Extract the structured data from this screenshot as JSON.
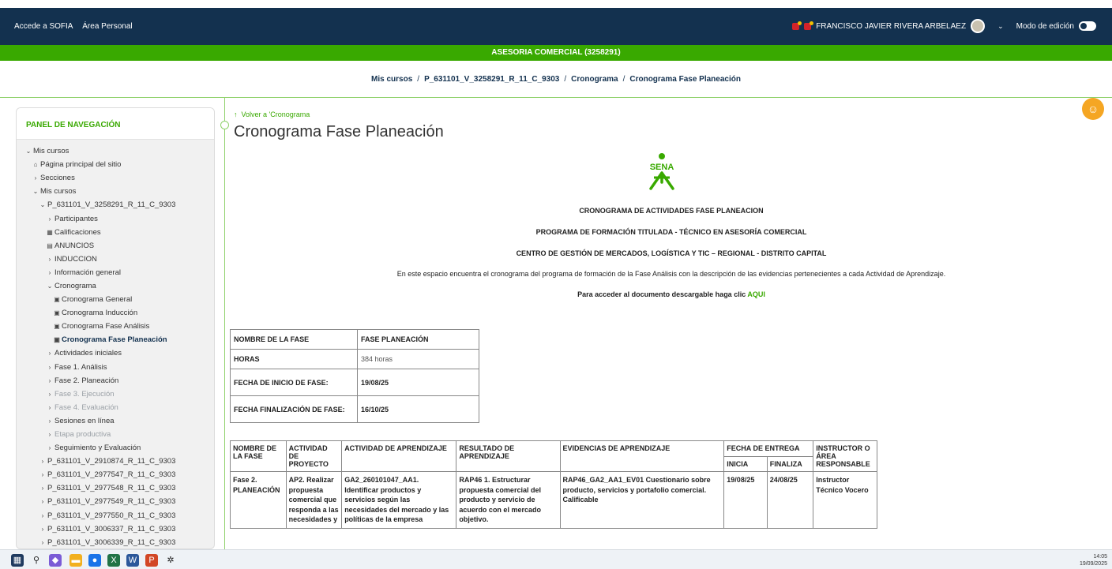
{
  "topbar": {
    "links": [
      "Accede a SOFIA",
      "Área Personal"
    ],
    "user_name": "FRANCISCO JAVIER RIVERA ARBELAEZ",
    "edit_mode_label": "Modo de edición"
  },
  "course_banner": "ASESORIA COMERCIAL (3258291)",
  "breadcrumb": [
    "Mis cursos",
    "P_631101_V_3258291_R_11_C_9303",
    "Cronograma",
    "Cronograma Fase Planeación"
  ],
  "sidebar": {
    "title": "PANEL DE NAVEGACIÓN",
    "items": [
      {
        "label": "Mis cursos",
        "icon": "v",
        "indent": 0
      },
      {
        "label": "Página principal del sitio",
        "icon": "home-icon",
        "indent": 1
      },
      {
        "label": "Secciones",
        "icon": ">",
        "indent": 1
      },
      {
        "label": "Mis cursos",
        "icon": "v",
        "indent": 1
      },
      {
        "label": "P_631101_V_3258291_R_11_C_9303",
        "icon": "v",
        "indent": 2
      },
      {
        "label": "Participantes",
        "icon": ">",
        "indent": 3
      },
      {
        "label": "Calificaciones",
        "icon": "grid-icon",
        "indent": 3
      },
      {
        "label": "ANUNCIOS",
        "icon": "forum-icon",
        "indent": 3
      },
      {
        "label": "INDUCCION",
        "icon": ">",
        "indent": 3
      },
      {
        "label": "Información general",
        "icon": ">",
        "indent": 3
      },
      {
        "label": "Cronograma",
        "icon": "v",
        "indent": 3
      },
      {
        "label": "Cronograma General",
        "icon": "page-icon",
        "indent": 4
      },
      {
        "label": "Cronograma Inducción",
        "icon": "page-icon",
        "indent": 4
      },
      {
        "label": "Cronograma Fase Análisis",
        "icon": "page-icon",
        "indent": 4
      },
      {
        "label": "Cronograma Fase Planeación",
        "icon": "page-icon",
        "indent": 4,
        "active": true
      },
      {
        "label": "Actividades iniciales",
        "icon": ">",
        "indent": 3
      },
      {
        "label": "Fase 1. Análisis",
        "icon": ">",
        "indent": 3
      },
      {
        "label": "Fase 2. Planeación",
        "icon": ">",
        "indent": 3
      },
      {
        "label": "Fase 3. Ejecución",
        "icon": ">",
        "indent": 3,
        "dim": true
      },
      {
        "label": "Fase 4. Evaluación",
        "icon": ">",
        "indent": 3,
        "dim": true
      },
      {
        "label": "Sesiones en línea",
        "icon": ">",
        "indent": 3
      },
      {
        "label": "Etapa productiva",
        "icon": ">",
        "indent": 3,
        "dim": true
      },
      {
        "label": "Seguimiento y Evaluación",
        "icon": ">",
        "indent": 3
      },
      {
        "label": "P_631101_V_2910874_R_11_C_9303",
        "icon": ">",
        "indent": 2
      },
      {
        "label": "P_631101_V_2977547_R_11_C_9303",
        "icon": ">",
        "indent": 2
      },
      {
        "label": "P_631101_V_2977548_R_11_C_9303",
        "icon": ">",
        "indent": 2
      },
      {
        "label": "P_631101_V_2977549_R_11_C_9303",
        "icon": ">",
        "indent": 2
      },
      {
        "label": "P_631101_V_2977550_R_11_C_9303",
        "icon": ">",
        "indent": 2
      },
      {
        "label": "P_631101_V_3006337_R_11_C_9303",
        "icon": ">",
        "indent": 2
      },
      {
        "label": "P_631101_V_3006339_R_11_C_9303",
        "icon": ">",
        "indent": 2
      }
    ]
  },
  "main": {
    "back_link": "Volver a 'Cronograma",
    "page_title": "Cronograma Fase Planeación",
    "logo_text": "SENA",
    "heading1": "CRONOGRAMA  DE ACTIVIDADES FASE PLANEACION",
    "heading2": "PROGRAMA DE FORMACIÓN TITULADA - TÉCNICO EN ASESORÍA COMERCIAL",
    "heading3": "CENTRO DE GESTIÓN DE MERCADOS, LOGÍSTICA Y TIC – REGIONAL - DISTRITO CAPITAL",
    "intro": "En este espacio encuentra el cronograma del programa de formación de la Fase Análisis con la descripción de las evidencias pertenecientes a cada Actividad de Aprendizaje.",
    "download_prefix": "Para acceder al documento descargable haga clic",
    "download_link": "AQUI"
  },
  "phase_table": [
    {
      "label": "NOMBRE DE LA FASE",
      "value": "FASE PLANEACIÓN"
    },
    {
      "label": "HORAS",
      "value": "384 horas"
    },
    {
      "label": "FECHA DE INICIO DE FASE:",
      "value": "19/08/25"
    },
    {
      "label": "FECHA FINALIZACIÓN DE FASE:",
      "value": "16/10/25"
    }
  ],
  "schedule_table": {
    "headers": [
      "NOMBRE DE LA FASE",
      "ACTIVIDAD DE PROYECTO",
      "ACTIVIDAD DE APRENDIZAJE",
      "RESULTADO DE APRENDIZAJE",
      "EVIDENCIAS DE APRENDIZAJE",
      "FECHA DE ENTREGA",
      "INSTRUCTOR O ÁREA RESPONSABLE"
    ],
    "date_subheaders": [
      "INICIA",
      "FINALIZA"
    ],
    "row": {
      "fase": "Fase 2. PLANEACIÓN",
      "actividad_proyecto": "AP2. Realizar propuesta comercial que responda a las necesidades y",
      "actividad_aprendizaje": "GA2_260101047_AA1. Identificar productos y servicios según las necesidades del mercado y las políticas de la empresa",
      "resultado": "RAP46 1. Estructurar propuesta comercial del producto y servicio de acuerdo con el mercado objetivo.",
      "evidencia": "RAP46_GA2_AA1_EV01 Cuestionario sobre  producto, servicios y portafolio comercial.",
      "evidencia_nota": "Calificable",
      "inicia": "19/08/25",
      "finaliza": "24/08/25",
      "instructor": "Instructor Técnico Vocero"
    }
  },
  "taskbar": {
    "time": "14:05",
    "date": "19/09/2025"
  },
  "colors": {
    "topbar": "#13314f",
    "green": "#39a900",
    "helper": "#f5a623"
  }
}
